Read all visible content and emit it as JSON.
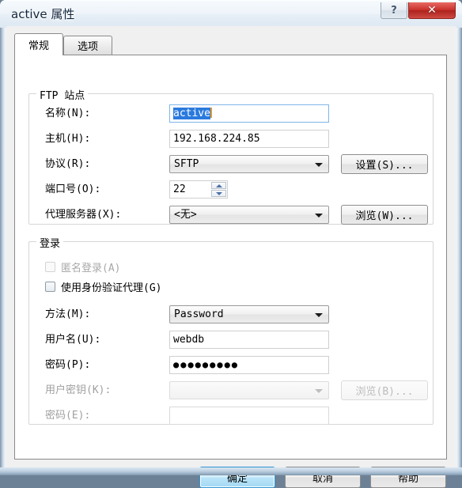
{
  "window": {
    "title": "active 属性",
    "help_button": "?",
    "close_button": "✕"
  },
  "tabs": [
    {
      "label": "常规",
      "active": true
    },
    {
      "label": "选项",
      "active": false
    }
  ],
  "ftp_group": {
    "title": "FTP 站点",
    "name_label": "名称(N):",
    "name_value": "active",
    "host_label": "主机(H):",
    "host_value": "192.168.224.85",
    "protocol_label": "协议(R):",
    "protocol_value": "SFTP",
    "settings_button": "设置(S)...",
    "port_label": "端口号(O):",
    "port_value": "22",
    "proxy_label": "代理服务器(X):",
    "proxy_value": "<无>",
    "proxy_browse_button": "浏览(W)..."
  },
  "login_group": {
    "title": "登录",
    "anonymous_label": "匿名登录(A)",
    "auth_agent_label": "使用身份验证代理(G)",
    "method_label": "方法(M):",
    "method_value": "Password",
    "username_label": "用户名(U):",
    "username_value": "webdb",
    "password_label": "密码(P):",
    "password_value": "●●●●●●●●●",
    "userkey_label": "用户密钥(K):",
    "userkey_value": "",
    "userkey_browse_button": "浏览(B)...",
    "keypass_label": "密码(E):",
    "keypass_value": ""
  },
  "footer": {
    "ok_button": "确定",
    "cancel_button": "取消",
    "help_button": "帮助"
  },
  "colors": {
    "accent": "#2a7ade",
    "close_red": "#c9322c",
    "selection_blue": "#2a7ade",
    "caret_orange": "#e09a34"
  }
}
